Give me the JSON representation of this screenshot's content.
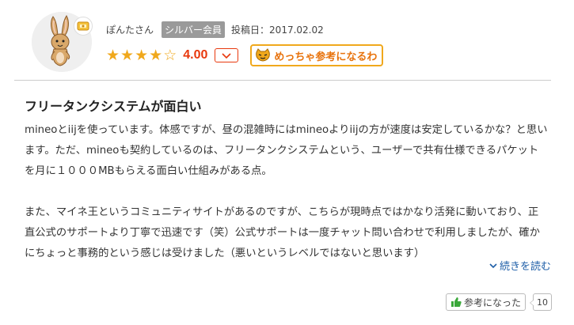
{
  "reviewer": {
    "name": "ぽんたさん",
    "rank": "シルバー会員",
    "date_label": "投稿日：",
    "date": "2017.02.02",
    "avatar_icon": "rabbit-avatar-icon",
    "badge_icon": "coin-badge-icon"
  },
  "rating": {
    "stars_filled": 4,
    "stars_total": 5,
    "score": "4.00",
    "toggle_icon": "chevron-down-icon",
    "like_big_label": "めっちゃ参考になるわ",
    "like_big_icon": "cat-face-icon"
  },
  "review": {
    "title": "フリータンクシステムが面白い",
    "paragraphs": [
      "mineoとiijを使っています。体感ですが、昼の混雑時にはmineoよりiijの方が速度は安定しているかな？と思います。ただ、mineoも契約しているのは、フリータンクシステムという、ユーザーで共有仕様できるパケットを月に１０００MBもらえる面白い仕組みがある点。",
      "また、マイネ王というコミュニティサイトがあるのですが、こちらが現時点ではかなり活発に動いており、正直公式のサポートより丁寧で迅速です（笑）公式サポートは一度チャット問い合わせで利用しましたが、確かにちょっと事務的という感じは受けました（悪いというレベルではないと思います）"
    ],
    "read_more": "続きを読む"
  },
  "helpful": {
    "label": "参考になった",
    "count": "10",
    "icon": "thumbs-up-icon"
  },
  "colors": {
    "star": "#f0a81c",
    "score": "#e8380d",
    "accent_orange": "#e8730d",
    "link": "#1f5fa8",
    "rank_badge": "#9a9a9a"
  }
}
